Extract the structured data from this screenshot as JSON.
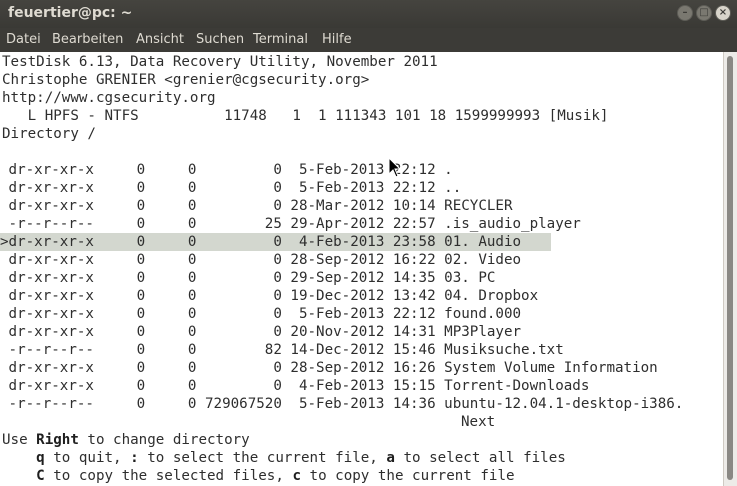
{
  "window": {
    "title": "feuertier@pc: ~",
    "buttons": {
      "close": "×",
      "minimize": "–",
      "maximize": "□"
    }
  },
  "menu": [
    "Datei",
    "Bearbeiten",
    "Ansicht",
    "Suchen",
    "Terminal",
    "Hilfe"
  ],
  "header": {
    "line1": "TestDisk 6.13, Data Recovery Utility, November 2011",
    "line2": "Christophe GRENIER <grenier@cgsecurity.org>",
    "line3": "http://www.cgsecurity.org",
    "partition": "   L HPFS - NTFS          11748   1  1 111343 101 18 1599999993 [Musik]",
    "directory": "Directory /"
  },
  "files": [
    " dr-xr-xr-x     0     0         0  5-Feb-2013 22:12 .",
    " dr-xr-xr-x     0     0         0  5-Feb-2013 22:12 ..",
    " dr-xr-xr-x     0     0         0 28-Mar-2012 10:14 RECYCLER",
    " -r--r--r--     0     0        25 29-Apr-2012 22:57 .is_audio_player",
    ">dr-xr-xr-x     0     0         0  4-Feb-2013 23:58 01. Audio",
    " dr-xr-xr-x     0     0         0 28-Sep-2012 16:22 02. Video",
    " dr-xr-xr-x     0     0         0 29-Sep-2012 14:35 03. PC",
    " dr-xr-xr-x     0     0         0 19-Dec-2012 13:42 04. Dropbox",
    " dr-xr-xr-x     0     0         0  5-Feb-2013 22:12 found.000",
    " dr-xr-xr-x     0     0         0 20-Nov-2012 14:31 MP3Player",
    " -r--r--r--     0     0        82 14-Dec-2012 15:46 Musiksuche.txt",
    " dr-xr-xr-x     0     0         0 28-Sep-2012 16:26 System Volume Information",
    " dr-xr-xr-x     0     0         0  4-Feb-2013 15:15 Torrent-Downloads",
    " -r--r--r--     0     0 729067520  5-Feb-2013 14:36 ubuntu-12.04.1-desktop-i386."
  ],
  "next_label": "Next",
  "help": {
    "l1_pre": "Use ",
    "l1_key": "Right",
    "l1_post": " to change directory",
    "l2_k1": "q",
    "l2_t1": " to quit, ",
    "l2_k2": ":",
    "l2_t2": " to select the current file, ",
    "l2_k3": "a",
    "l2_t3": " to select all files",
    "l3_k1": "C",
    "l3_t1": " to copy the selected files, ",
    "l3_k2": "c",
    "l3_t2": " to copy the current file"
  },
  "selected_index": 4,
  "colors": {
    "terminal_bg": "#ffffff",
    "selection_bg": "#d3d7cf",
    "chrome": "#3c3b37"
  }
}
